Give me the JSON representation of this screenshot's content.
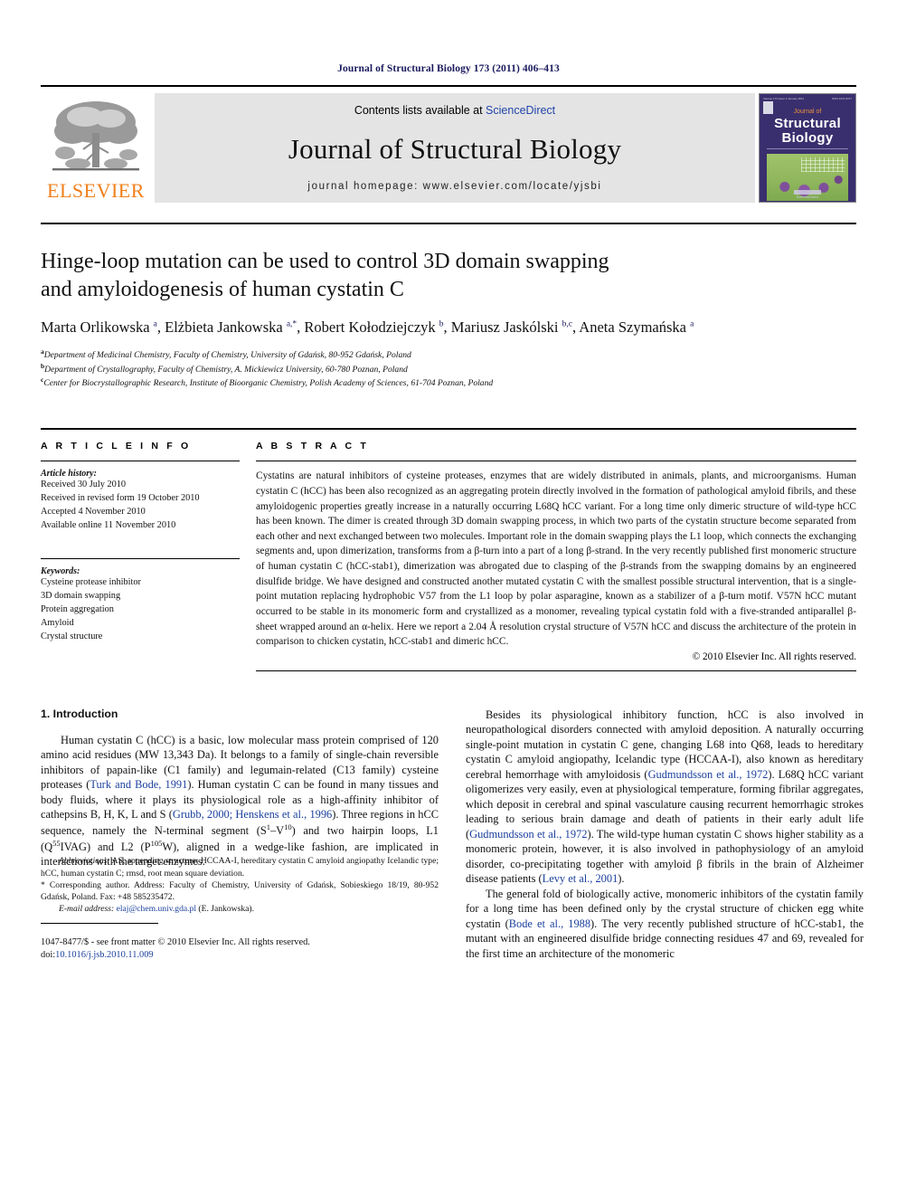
{
  "running_head": "Journal of Structural Biology 173 (2011) 406–413",
  "masthead": {
    "contents_prefix": "Contents lists available at ",
    "contents_link": "ScienceDirect",
    "journal_title": "Journal of Structural Biology",
    "homepage": "journal homepage: www.elsevier.com/locate/yjsbi",
    "publisher": "ELSEVIER",
    "cover": {
      "top_left": "Volume 173 Issue 3  January 2011",
      "top_right": "ISSN 1047-8477",
      "journal_of": "Journal of",
      "line1": "Structural",
      "line2": "Biology",
      "footer": "Available online at www.sciencedirect.com",
      "sciencedirect": "ScienceDirect"
    }
  },
  "article": {
    "title_line1": "Hinge-loop mutation can be used to control 3D domain swapping",
    "title_line2": "and amyloidogenesis of human cystatin C",
    "authors_html": "Marta Orlikowska <sup>a</sup>, El&#380;bieta Jankowska <sup>a,</sup><sup>*</sup>, Robert Ko&#322;odziejczyk <sup>b</sup>, Mariusz Jask&oacute;lski <sup>b,c</sup>, Aneta Szyma&#324;ska <sup>a</sup>",
    "affiliations": [
      "Department of Medicinal Chemistry, Faculty of Chemistry, University of Gdańsk, 80-952 Gdańsk, Poland",
      "Department of Crystallography, Faculty of Chemistry, A. Mickiewicz University, 60-780 Poznan, Poland",
      "Center for Biocrystallographic Research, Institute of Bioorganic Chemistry, Polish Academy of Sciences, 61-704 Poznan, Poland"
    ],
    "affiliation_markers": [
      "a",
      "b",
      "c"
    ]
  },
  "article_info": {
    "heading": "A R T I C L E   I N F O",
    "history_label": "Article history:",
    "history": [
      "Received 30 July 2010",
      "Received in revised form 19 October 2010",
      "Accepted 4 November 2010",
      "Available online 11 November 2010"
    ],
    "keywords_label": "Keywords:",
    "keywords": [
      "Cysteine protease inhibitor",
      "3D domain swapping",
      "Protein aggregation",
      "Amyloid",
      "Crystal structure"
    ]
  },
  "abstract": {
    "heading": "A B S T R A C T",
    "text": "Cystatins are natural inhibitors of cysteine proteases, enzymes that are widely distributed in animals, plants, and microorganisms. Human cystatin C (hCC) has been also recognized as an aggregating protein directly involved in the formation of pathological amyloid fibrils, and these amyloidogenic properties greatly increase in a naturally occurring L68Q hCC variant. For a long time only dimeric structure of wild-type hCC has been known. The dimer is created through 3D domain swapping process, in which two parts of the cystatin structure become separated from each other and next exchanged between two molecules. Important role in the domain swapping plays the L1 loop, which connects the exchanging segments and, upon dimerization, transforms from a β-turn into a part of a long β-strand. In the very recently published first monomeric structure of human cystatin C (hCC-stab1), dimerization was abrogated due to clasping of the β-strands from the swapping domains by an engineered disulfide bridge. We have designed and constructed another mutated cystatin C with the smallest possible structural intervention, that is a single-point mutation replacing hydrophobic V57 from the L1 loop by polar asparagine, known as a stabilizer of a β-turn motif. V57N hCC mutant occurred to be stable in its monomeric form and crystallized as a monomer, revealing typical cystatin fold with a five-stranded antiparallel β-sheet wrapped around an α-helix. Here we report a 2.04 Å resolution crystal structure of V57N hCC and discuss the architecture of the protein in comparison to chicken cystatin, hCC-stab1 and dimeric hCC.",
    "copyright": "© 2010 Elsevier Inc. All rights reserved."
  },
  "introduction": {
    "heading": "1. Introduction",
    "left_paragraph_html": "Human cystatin C (hCC) is a basic, low molecular mass protein comprised of 120 amino acid residues (MW 13,343 Da). It belongs to a family of single-chain reversible inhibitors of papain-like (C1 family) and legumain-related (C13 family) cysteine proteases (<span class=\"ref\">Turk and Bode, 1991</span>). Human cystatin C can be found in many tissues and body fluids, where it plays its physiological role as a high-affinity inhibitor of cathepsins B, H, K, L and S (<span class=\"ref\">Grubb, 2000; Henskens et al., 1996</span>). Three regions in hCC sequence, namely the N-terminal segment (S<sup class=\"sm\">1</sup>&ndash;V<sup class=\"sm\">10</sup>) and two hairpin loops, L1 (Q<sup class=\"sm\">55</sup>IVAG) and L2 (P<sup class=\"sm\">105</sup>W), aligned in a wedge-like fashion, are implicated in interactions with the target enzymes.",
    "right_paragraph_1_html": "Besides its physiological inhibitory function, hCC is also involved in neuropathological disorders connected with amyloid deposition. A naturally occurring single-point mutation in cystatin C gene, changing L68 into Q68, leads to hereditary cystatin C amyloid angiopathy, Icelandic type (HCCAA-I), also known as hereditary cerebral hemorrhage with amyloidosis (<span class=\"ref\">Gudmundsson et al., 1972</span>). L68Q hCC variant oligomerizes very easily, even at physiological temperature, forming fibrilar aggregates, which deposit in cerebral and spinal vasculature causing recurrent hemorrhagic strokes leading to serious brain damage and death of patients in their early adult life (<span class=\"ref\">Gudmundsson et al., 1972</span>). The wild-type human cystatin C shows higher stability as a monomeric protein, however, it is also involved in pathophysiology of an amyloid disorder, co-precipitating together with amyloid β fibrils in the brain of Alzheimer disease patients (<span class=\"ref\">Levy et al., 2001</span>).",
    "right_paragraph_2_html": "The general fold of biologically active, monomeric inhibitors of the cystatin family for a long time has been defined only by the crystal structure of chicken egg white cystatin (<span class=\"ref\">Bode et al., 1988</span>). The very recently published structure of hCC-stab1, the mutant with an engineered disulfide bridge connecting residues 47 and 69, revealed for the first time an architecture of the monomeric"
  },
  "footnotes": {
    "abbreviations_html": "<i>Abbreviations:</i> AS, appending structure; HCCAA-I, hereditary cystatin C amyloid angiopathy Icelandic type; hCC, human cystatin C; rmsd, root mean square deviation.",
    "corresponding_html": "* Corresponding author. Address: Faculty of Chemistry, University of Gda&#324;sk, Sobieskiego 18/19, 80-952 Gda&#324;sk, Poland. Fax: +48 585235472.",
    "email_label": "E-mail address:",
    "email": "elaj@chem.univ.gda.pl",
    "email_suffix": "(E. Jankowska)."
  },
  "imprint": {
    "line1": "1047-8477/$ - see front matter © 2010 Elsevier Inc. All rights reserved.",
    "doi_prefix": "doi:",
    "doi": "10.1016/j.jsb.2010.11.009"
  },
  "colors": {
    "link": "#1a3f9e",
    "elsevier_orange": "#f07f1a",
    "running_head": "#1a1a5e",
    "masthead_bg": "#e4e4e4",
    "cover_bg": "#3a2f6e"
  }
}
